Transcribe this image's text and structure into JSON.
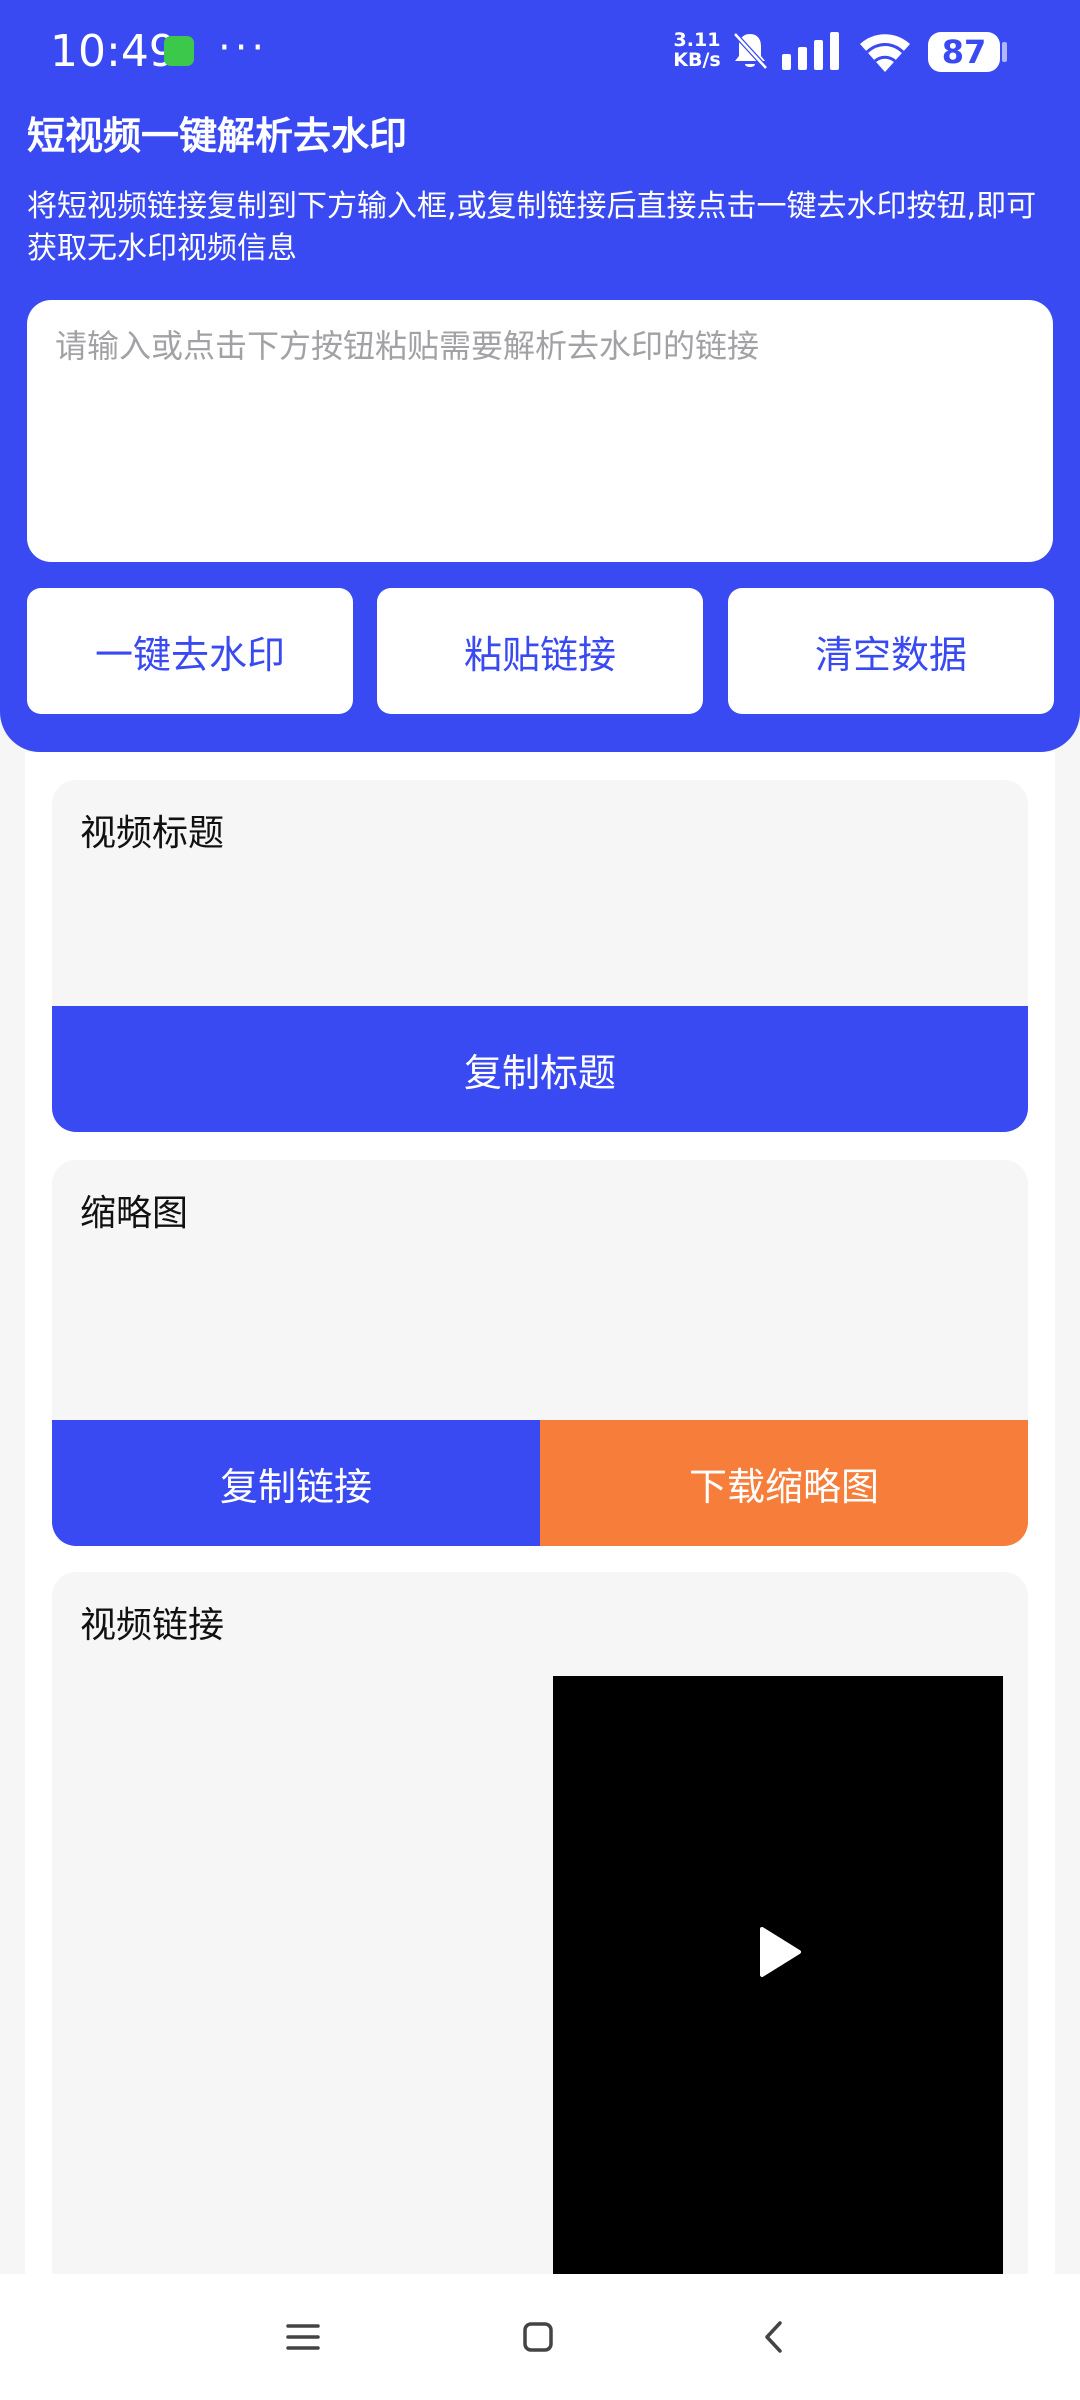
{
  "status_bar": {
    "time": "10:49",
    "dots": "···",
    "speed_value": "3.11",
    "speed_unit": "KB/s",
    "battery": "87",
    "colors": {
      "app_icon": "#3cc84a"
    }
  },
  "header": {
    "title": "短视频一键解析去水印",
    "description": "将短视频链接复制到下方输入框,或复制链接后直接点击一键去水印按钮,即可获取无水印视频信息",
    "input_placeholder": "请输入或点击下方按钮粘贴需要解析去水印的链接",
    "input_value": "",
    "buttons": {
      "remove_watermark": "一键去水印",
      "paste_link": "粘贴链接",
      "clear_data": "清空数据"
    }
  },
  "cards": {
    "title_card": {
      "label": "视频标题",
      "button": "复制标题"
    },
    "thumbnail_card": {
      "label": "缩略图",
      "copy_button": "复制链接",
      "download_button": "下载缩略图"
    },
    "video_card": {
      "label": "视频链接"
    }
  },
  "icons": {
    "bell_muted": "bell-off-icon",
    "signal": "signal-icon",
    "wifi": "wifi-icon",
    "play": "play-icon",
    "nav_menu": "menu-icon",
    "nav_home": "home-icon",
    "nav_back": "back-icon"
  },
  "colors": {
    "primary": "#3a4af2",
    "accent": "#f77d3a",
    "card_background": "#f6f6f7",
    "video_background": "#000000"
  }
}
